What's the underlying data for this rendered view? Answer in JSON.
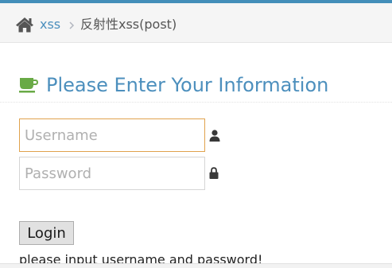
{
  "colors": {
    "accent": "#438eb9",
    "link": "#4c8fbd",
    "coffee_icon": "#69aa46",
    "focus_border": "#e0a24d"
  },
  "breadcrumb": {
    "home_icon": "home-icon",
    "home_label": "xss",
    "separator_icon": "chevron-right-icon",
    "current": "反射性xss(post)"
  },
  "header": {
    "icon": "coffee-icon",
    "title": "Please Enter Your Information"
  },
  "form": {
    "username_placeholder": "Username",
    "username_value": "",
    "username_icon": "user-icon",
    "password_placeholder": "Password",
    "password_value": "",
    "password_icon": "lock-icon",
    "login_label": "Login"
  },
  "status": {
    "message": "please input username and password!"
  }
}
